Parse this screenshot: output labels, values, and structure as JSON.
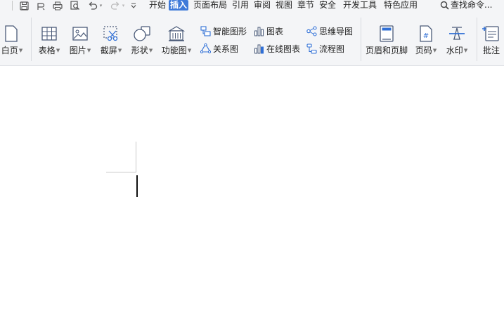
{
  "quick_access": {
    "icons": [
      "save-icon",
      "convert-icon",
      "print-icon",
      "print-preview-icon",
      "undo-icon",
      "redo-icon",
      "customize-dropdown-icon"
    ]
  },
  "menu": {
    "tabs": [
      "开始",
      "插入",
      "页面布局",
      "引用",
      "审阅",
      "视图",
      "章节",
      "安全",
      "开发工具",
      "特色应用"
    ],
    "active_tab": "插入",
    "search_label": "查找命令..."
  },
  "ribbon": {
    "blank_page": "白页",
    "table": "表格",
    "picture": "图片",
    "screenshot": "截屏",
    "shape": "形状",
    "function_chart": "功能图",
    "smart_shape": "智能图形",
    "relationship_chart": "关系图",
    "chart": "图表",
    "online_chart": "在线图表",
    "mind_map": "思维导图",
    "flowchart": "流程图",
    "header_footer": "页眉和页脚",
    "page_number": "页码",
    "watermark": "水印",
    "comment": "批注"
  },
  "colors": {
    "accent": "#3f7ad9",
    "ribbon_bg": "#f4f5f7",
    "icon_stroke": "#4a5a78"
  }
}
